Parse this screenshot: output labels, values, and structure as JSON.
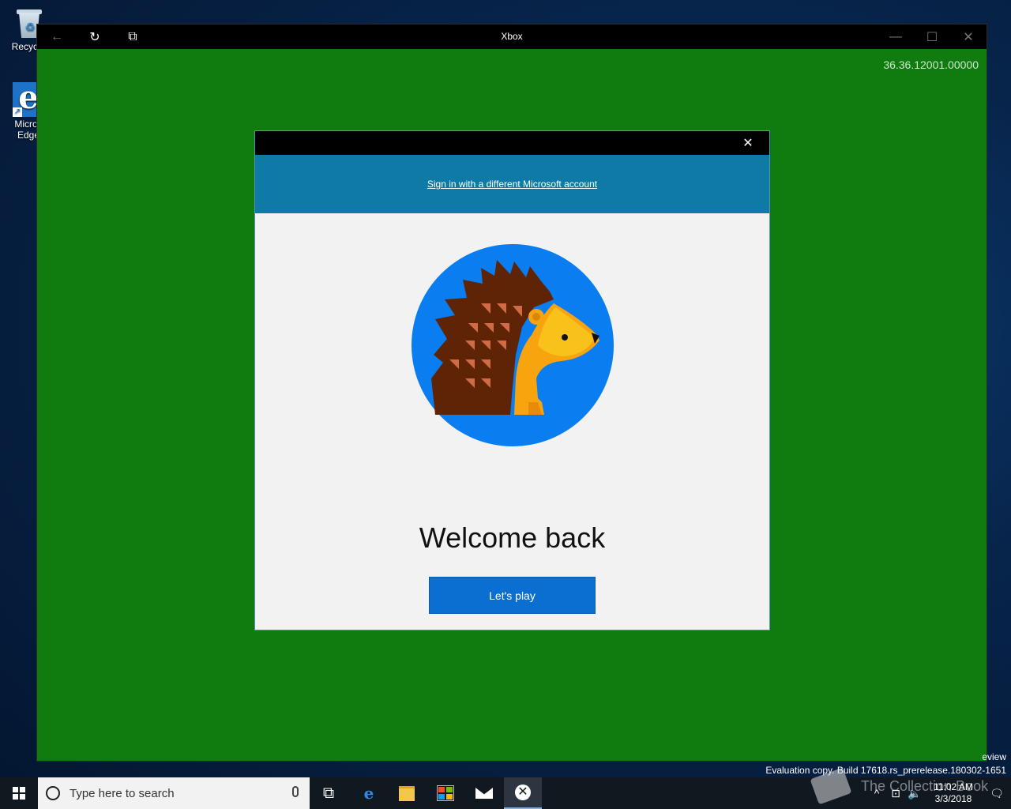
{
  "desktop": {
    "icons": [
      {
        "label": "Recycle",
        "icon": "recycle-bin-icon"
      },
      {
        "label": "Micros Edge",
        "icon": "edge-icon"
      }
    ]
  },
  "window": {
    "title": "Xbox",
    "version": "36.36.12001.00000",
    "buttons": {
      "back": "←",
      "refresh": "↻",
      "mini": "⧉",
      "minimize": "—",
      "maximize": "☐",
      "close": "✕"
    }
  },
  "dialog": {
    "close": "✕",
    "switch_account": "Sign in with a different Microsoft account",
    "welcome": "Welcome back",
    "lets_play": "Let's play",
    "colors": {
      "banner": "#0f7aa6",
      "button": "#0b6fd2",
      "avatar_bg": "#0a7df0"
    }
  },
  "watermark": {
    "edition": "eview",
    "build": "Evaluation copy. Build 17618.rs_prerelease.180302-1651"
  },
  "taskbar": {
    "search_placeholder": "Type here to search",
    "edge_glyph": "e",
    "taskview_glyph": "⧉",
    "clock_time": "11:02 AM",
    "clock_date": "3/3/2018",
    "overlay_text": "The Collection Book",
    "tray": {
      "chevron": "^",
      "network": "⊡",
      "volume": "🔈",
      "notifications": "🗨"
    }
  }
}
